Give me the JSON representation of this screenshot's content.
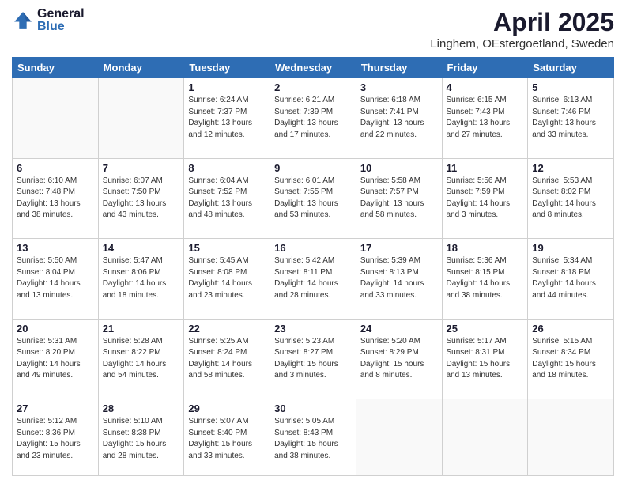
{
  "logo": {
    "general": "General",
    "blue": "Blue"
  },
  "header": {
    "title": "April 2025",
    "subtitle": "Linghem, OEstergoetland, Sweden"
  },
  "weekdays": [
    "Sunday",
    "Monday",
    "Tuesday",
    "Wednesday",
    "Thursday",
    "Friday",
    "Saturday"
  ],
  "weeks": [
    [
      {
        "day": "",
        "info": ""
      },
      {
        "day": "",
        "info": ""
      },
      {
        "day": "1",
        "info": "Sunrise: 6:24 AM\nSunset: 7:37 PM\nDaylight: 13 hours and 12 minutes."
      },
      {
        "day": "2",
        "info": "Sunrise: 6:21 AM\nSunset: 7:39 PM\nDaylight: 13 hours and 17 minutes."
      },
      {
        "day": "3",
        "info": "Sunrise: 6:18 AM\nSunset: 7:41 PM\nDaylight: 13 hours and 22 minutes."
      },
      {
        "day": "4",
        "info": "Sunrise: 6:15 AM\nSunset: 7:43 PM\nDaylight: 13 hours and 27 minutes."
      },
      {
        "day": "5",
        "info": "Sunrise: 6:13 AM\nSunset: 7:46 PM\nDaylight: 13 hours and 33 minutes."
      }
    ],
    [
      {
        "day": "6",
        "info": "Sunrise: 6:10 AM\nSunset: 7:48 PM\nDaylight: 13 hours and 38 minutes."
      },
      {
        "day": "7",
        "info": "Sunrise: 6:07 AM\nSunset: 7:50 PM\nDaylight: 13 hours and 43 minutes."
      },
      {
        "day": "8",
        "info": "Sunrise: 6:04 AM\nSunset: 7:52 PM\nDaylight: 13 hours and 48 minutes."
      },
      {
        "day": "9",
        "info": "Sunrise: 6:01 AM\nSunset: 7:55 PM\nDaylight: 13 hours and 53 minutes."
      },
      {
        "day": "10",
        "info": "Sunrise: 5:58 AM\nSunset: 7:57 PM\nDaylight: 13 hours and 58 minutes."
      },
      {
        "day": "11",
        "info": "Sunrise: 5:56 AM\nSunset: 7:59 PM\nDaylight: 14 hours and 3 minutes."
      },
      {
        "day": "12",
        "info": "Sunrise: 5:53 AM\nSunset: 8:02 PM\nDaylight: 14 hours and 8 minutes."
      }
    ],
    [
      {
        "day": "13",
        "info": "Sunrise: 5:50 AM\nSunset: 8:04 PM\nDaylight: 14 hours and 13 minutes."
      },
      {
        "day": "14",
        "info": "Sunrise: 5:47 AM\nSunset: 8:06 PM\nDaylight: 14 hours and 18 minutes."
      },
      {
        "day": "15",
        "info": "Sunrise: 5:45 AM\nSunset: 8:08 PM\nDaylight: 14 hours and 23 minutes."
      },
      {
        "day": "16",
        "info": "Sunrise: 5:42 AM\nSunset: 8:11 PM\nDaylight: 14 hours and 28 minutes."
      },
      {
        "day": "17",
        "info": "Sunrise: 5:39 AM\nSunset: 8:13 PM\nDaylight: 14 hours and 33 minutes."
      },
      {
        "day": "18",
        "info": "Sunrise: 5:36 AM\nSunset: 8:15 PM\nDaylight: 14 hours and 38 minutes."
      },
      {
        "day": "19",
        "info": "Sunrise: 5:34 AM\nSunset: 8:18 PM\nDaylight: 14 hours and 44 minutes."
      }
    ],
    [
      {
        "day": "20",
        "info": "Sunrise: 5:31 AM\nSunset: 8:20 PM\nDaylight: 14 hours and 49 minutes."
      },
      {
        "day": "21",
        "info": "Sunrise: 5:28 AM\nSunset: 8:22 PM\nDaylight: 14 hours and 54 minutes."
      },
      {
        "day": "22",
        "info": "Sunrise: 5:25 AM\nSunset: 8:24 PM\nDaylight: 14 hours and 58 minutes."
      },
      {
        "day": "23",
        "info": "Sunrise: 5:23 AM\nSunset: 8:27 PM\nDaylight: 15 hours and 3 minutes."
      },
      {
        "day": "24",
        "info": "Sunrise: 5:20 AM\nSunset: 8:29 PM\nDaylight: 15 hours and 8 minutes."
      },
      {
        "day": "25",
        "info": "Sunrise: 5:17 AM\nSunset: 8:31 PM\nDaylight: 15 hours and 13 minutes."
      },
      {
        "day": "26",
        "info": "Sunrise: 5:15 AM\nSunset: 8:34 PM\nDaylight: 15 hours and 18 minutes."
      }
    ],
    [
      {
        "day": "27",
        "info": "Sunrise: 5:12 AM\nSunset: 8:36 PM\nDaylight: 15 hours and 23 minutes."
      },
      {
        "day": "28",
        "info": "Sunrise: 5:10 AM\nSunset: 8:38 PM\nDaylight: 15 hours and 28 minutes."
      },
      {
        "day": "29",
        "info": "Sunrise: 5:07 AM\nSunset: 8:40 PM\nDaylight: 15 hours and 33 minutes."
      },
      {
        "day": "30",
        "info": "Sunrise: 5:05 AM\nSunset: 8:43 PM\nDaylight: 15 hours and 38 minutes."
      },
      {
        "day": "",
        "info": ""
      },
      {
        "day": "",
        "info": ""
      },
      {
        "day": "",
        "info": ""
      }
    ]
  ]
}
